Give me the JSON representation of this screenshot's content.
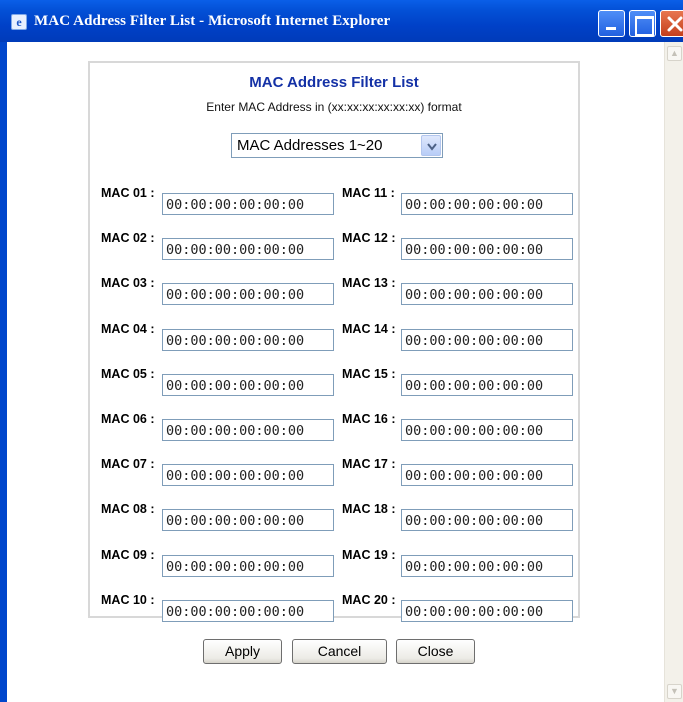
{
  "window": {
    "title": "MAC Address Filter List - Microsoft Internet Explorer",
    "icon": "ie-icon"
  },
  "panel": {
    "title": "MAC Address Filter List",
    "subtitle": "Enter MAC Address in (xx:xx:xx:xx:xx:xx) format"
  },
  "range_select": {
    "value": "MAC Addresses 1~20"
  },
  "mac_entries": [
    {
      "label": "MAC 01 :",
      "value": "00:00:00:00:00:00"
    },
    {
      "label": "MAC 02 :",
      "value": "00:00:00:00:00:00"
    },
    {
      "label": "MAC 03 :",
      "value": "00:00:00:00:00:00"
    },
    {
      "label": "MAC 04 :",
      "value": "00:00:00:00:00:00"
    },
    {
      "label": "MAC 05 :",
      "value": "00:00:00:00:00:00"
    },
    {
      "label": "MAC 06 :",
      "value": "00:00:00:00:00:00"
    },
    {
      "label": "MAC 07 :",
      "value": "00:00:00:00:00:00"
    },
    {
      "label": "MAC 08 :",
      "value": "00:00:00:00:00:00"
    },
    {
      "label": "MAC 09 :",
      "value": "00:00:00:00:00:00"
    },
    {
      "label": "MAC 10 :",
      "value": "00:00:00:00:00:00"
    },
    {
      "label": "MAC 11 :",
      "value": "00:00:00:00:00:00"
    },
    {
      "label": "MAC 12 :",
      "value": "00:00:00:00:00:00"
    },
    {
      "label": "MAC 13 :",
      "value": "00:00:00:00:00:00"
    },
    {
      "label": "MAC 14 :",
      "value": "00:00:00:00:00:00"
    },
    {
      "label": "MAC 15 :",
      "value": "00:00:00:00:00:00"
    },
    {
      "label": "MAC 16 :",
      "value": "00:00:00:00:00:00"
    },
    {
      "label": "MAC 17 :",
      "value": "00:00:00:00:00:00"
    },
    {
      "label": "MAC 18 :",
      "value": "00:00:00:00:00:00"
    },
    {
      "label": "MAC 19 :",
      "value": "00:00:00:00:00:00"
    },
    {
      "label": "MAC 20 :",
      "value": "00:00:00:00:00:00"
    }
  ],
  "buttons": {
    "apply": "Apply",
    "cancel": "Cancel",
    "close": "Close"
  }
}
